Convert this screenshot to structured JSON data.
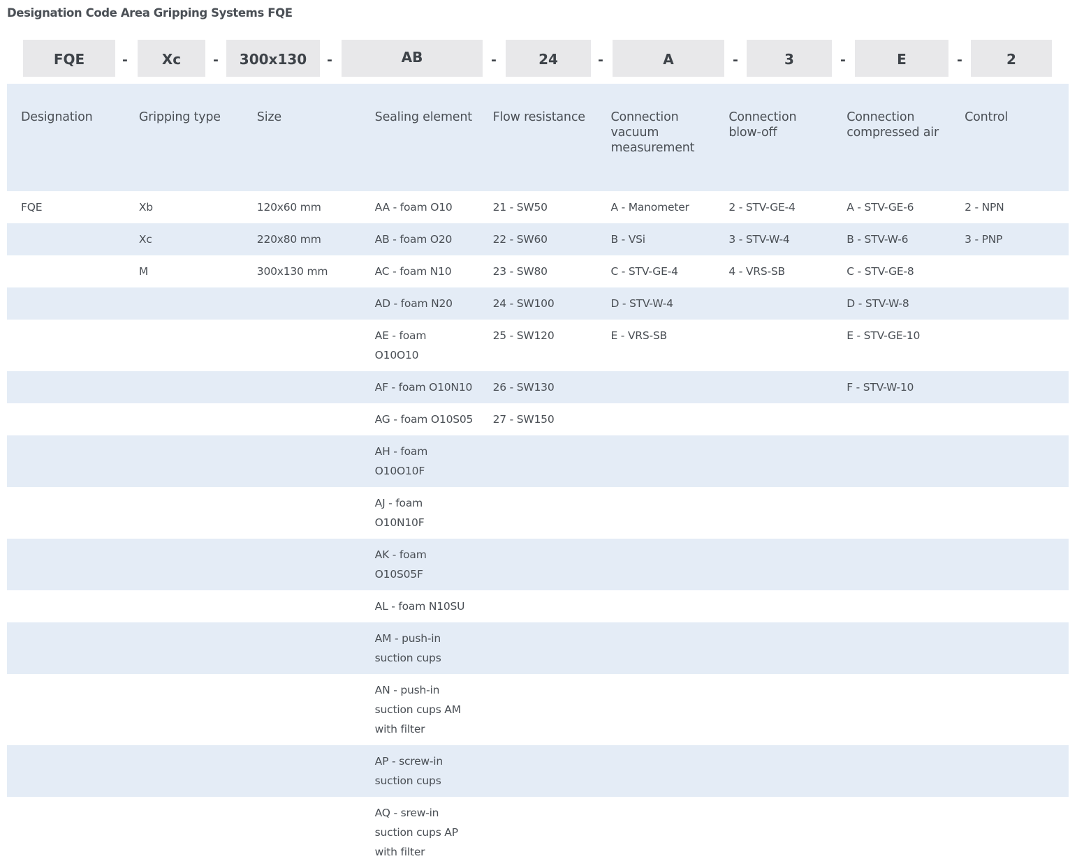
{
  "page": {
    "title": "Designation Code Area Gripping Systems FQE"
  },
  "code": {
    "segments": [
      "FQE",
      "Xc",
      "300x130",
      "AB",
      "24",
      "A",
      "3",
      "E",
      "2"
    ],
    "separator": "-"
  },
  "table": {
    "headers": [
      "Designation",
      "Gripping type",
      "Size",
      "Sealing element",
      "Flow resistance",
      "Connection vacuum measurement",
      "Connection blow-off",
      "Connection compressed air",
      "Control"
    ],
    "rows": [
      [
        "FQE",
        "Xb",
        "120x60 mm",
        "AA - foam O10",
        "21 - SW50",
        "A - Manometer",
        "2 - STV-GE-4",
        "A - STV-GE-6",
        "2 - NPN"
      ],
      [
        "",
        "Xc",
        "220x80 mm",
        "AB - foam O20",
        "22 - SW60",
        "B - VSi",
        "3 - STV-W-4",
        "B - STV-W-6",
        "3 - PNP"
      ],
      [
        "",
        "M",
        "300x130 mm",
        "AC - foam N10",
        "23 - SW80",
        "C - STV-GE-4",
        "4 - VRS-SB",
        "C - STV-GE-8",
        ""
      ],
      [
        "",
        "",
        "",
        "AD - foam N20",
        "24 - SW100",
        "D - STV-W-4",
        "",
        "D - STV-W-8",
        ""
      ],
      [
        "",
        "",
        "",
        "AE - foam O10O10",
        "25 - SW120",
        "E - VRS-SB",
        "",
        "E - STV-GE-10",
        ""
      ],
      [
        "",
        "",
        "",
        "AF - foam O10N10",
        "26 - SW130",
        "",
        "",
        "F - STV-W-10",
        ""
      ],
      [
        "",
        "",
        "",
        "AG - foam O10S05",
        "27 - SW150",
        "",
        "",
        "",
        ""
      ],
      [
        "",
        "",
        "",
        "AH - foam O10O10F",
        "",
        "",
        "",
        "",
        ""
      ],
      [
        "",
        "",
        "",
        "AJ - foam O10N10F",
        "",
        "",
        "",
        "",
        ""
      ],
      [
        "",
        "",
        "",
        "AK - foam O10S05F",
        "",
        "",
        "",
        "",
        ""
      ],
      [
        "",
        "",
        "",
        "AL - foam N10SU",
        "",
        "",
        "",
        "",
        ""
      ],
      [
        "",
        "",
        "",
        "AM - push-in suction cups",
        "",
        "",
        "",
        "",
        ""
      ],
      [
        "",
        "",
        "",
        "AN - push-in suction cups AM with filter",
        "",
        "",
        "",
        "",
        ""
      ],
      [
        "",
        "",
        "",
        "AP - screw-in suction cups",
        "",
        "",
        "",
        "",
        ""
      ],
      [
        "",
        "",
        "",
        "AQ - srew-in suction cups AP with filter",
        "",
        "",
        "",
        "",
        ""
      ]
    ]
  },
  "colors": {
    "shaded_row": "#e4ecf6",
    "code_box": "#e8e8ea",
    "text": "#4a4f55"
  }
}
